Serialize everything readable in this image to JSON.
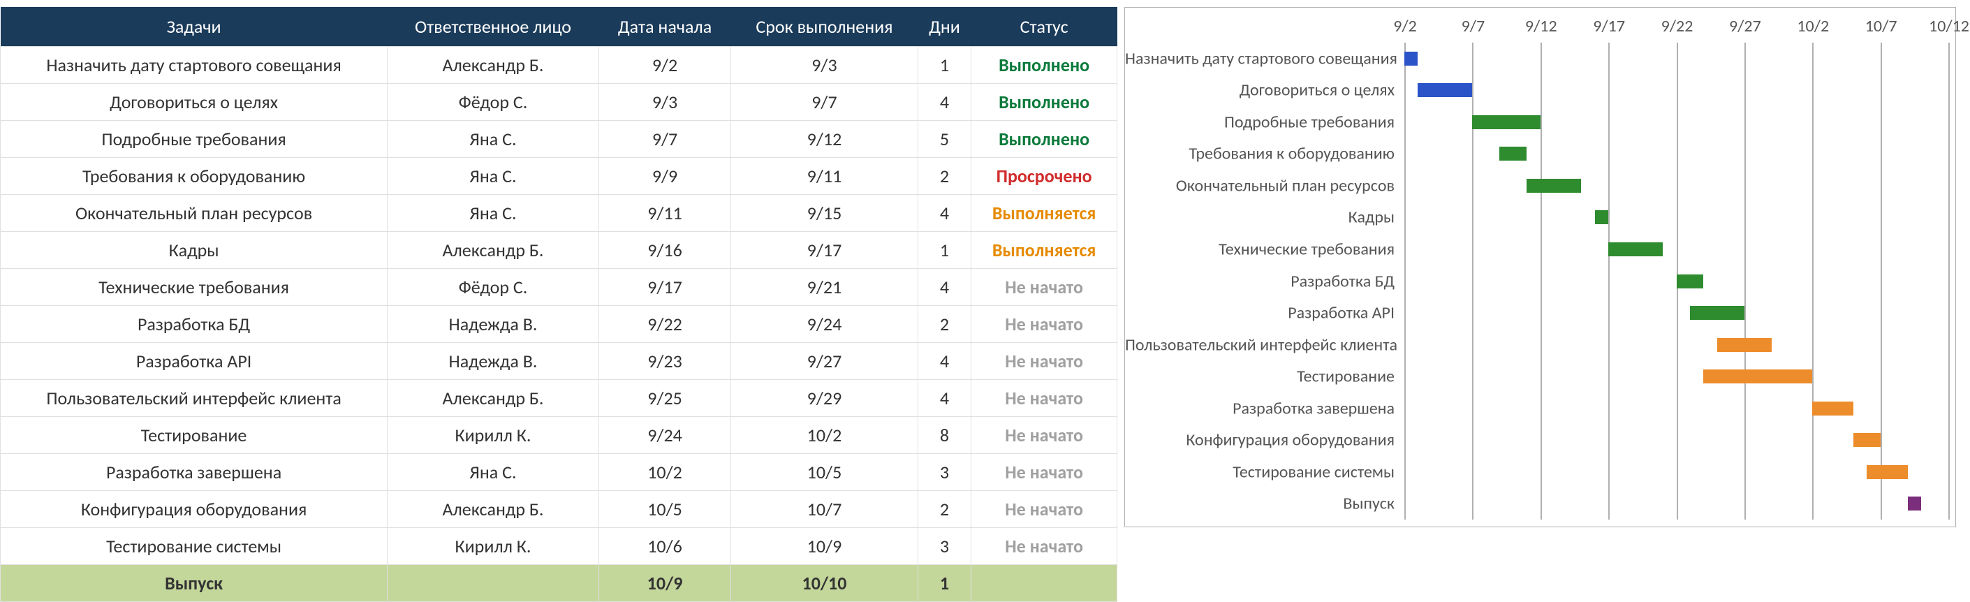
{
  "table": {
    "headers": [
      "Задачи",
      "Ответственное лицо",
      "Дата начала",
      "Срок выполнения",
      "Дни",
      "Статус"
    ],
    "rows": [
      {
        "task": "Назначить дату стартового совещания",
        "who": "Александр Б.",
        "start": "9/2",
        "end": "9/3",
        "days": "1",
        "status": "Выполнено",
        "status_kind": "done"
      },
      {
        "task": "Договориться о целях",
        "who": "Фёдор С.",
        "start": "9/3",
        "end": "9/7",
        "days": "4",
        "status": "Выполнено",
        "status_kind": "done"
      },
      {
        "task": "Подробные требования",
        "who": "Яна С.",
        "start": "9/7",
        "end": "9/12",
        "days": "5",
        "status": "Выполнено",
        "status_kind": "done"
      },
      {
        "task": "Требования к оборудованию",
        "who": "Яна С.",
        "start": "9/9",
        "end": "9/11",
        "days": "2",
        "status": "Просрочено",
        "status_kind": "late"
      },
      {
        "task": "Окончательный план ресурсов",
        "who": "Яна С.",
        "start": "9/11",
        "end": "9/15",
        "days": "4",
        "status": "Выполняется",
        "status_kind": "prog"
      },
      {
        "task": "Кадры",
        "who": "Александр Б.",
        "start": "9/16",
        "end": "9/17",
        "days": "1",
        "status": "Выполняется",
        "status_kind": "prog"
      },
      {
        "task": "Технические требования",
        "who": "Фёдор С.",
        "start": "9/17",
        "end": "9/21",
        "days": "4",
        "status": "Не начато",
        "status_kind": "ns"
      },
      {
        "task": "Разработка БД",
        "who": "Надежда В.",
        "start": "9/22",
        "end": "9/24",
        "days": "2",
        "status": "Не начато",
        "status_kind": "ns"
      },
      {
        "task": "Разработка API",
        "who": "Надежда В.",
        "start": "9/23",
        "end": "9/27",
        "days": "4",
        "status": "Не начато",
        "status_kind": "ns"
      },
      {
        "task": "Пользовательский интерфейс клиента",
        "who": "Александр Б.",
        "start": "9/25",
        "end": "9/29",
        "days": "4",
        "status": "Не начато",
        "status_kind": "ns"
      },
      {
        "task": "Тестирование",
        "who": "Кирилл К.",
        "start": "9/24",
        "end": "10/2",
        "days": "8",
        "status": "Не начато",
        "status_kind": "ns"
      },
      {
        "task": "Разработка завершена",
        "who": "Яна С.",
        "start": "10/2",
        "end": "10/5",
        "days": "3",
        "status": "Не начато",
        "status_kind": "ns"
      },
      {
        "task": "Конфигурация оборудования",
        "who": "Александр Б.",
        "start": "10/5",
        "end": "10/7",
        "days": "2",
        "status": "Не начато",
        "status_kind": "ns"
      },
      {
        "task": "Тестирование системы",
        "who": "Кирилл К.",
        "start": "10/6",
        "end": "10/9",
        "days": "3",
        "status": "Не начато",
        "status_kind": "ns"
      },
      {
        "task": "Выпуск",
        "who": "",
        "start": "10/9",
        "end": "10/10",
        "days": "1",
        "status": "",
        "status_kind": "milestone"
      }
    ]
  },
  "chart_data": {
    "type": "gantt",
    "x_ticks": [
      "9/2",
      "9/7",
      "9/12",
      "9/17",
      "9/22",
      "9/27",
      "10/2",
      "10/7",
      "10/12"
    ],
    "x_min_serial": 245,
    "x_max_serial": 285,
    "series": [
      {
        "name": "Назначить дату стартового совещания",
        "start": 245,
        "dur": 1,
        "color": "blue"
      },
      {
        "name": "Договориться о целях",
        "start": 246,
        "dur": 4,
        "color": "blue"
      },
      {
        "name": "Подробные требования",
        "start": 250,
        "dur": 5,
        "color": "green"
      },
      {
        "name": "Требования к оборудованию",
        "start": 252,
        "dur": 2,
        "color": "green"
      },
      {
        "name": "Окончательный план ресурсов",
        "start": 254,
        "dur": 4,
        "color": "green"
      },
      {
        "name": "Кадры",
        "start": 259,
        "dur": 1,
        "color": "green"
      },
      {
        "name": "Технические требования",
        "start": 260,
        "dur": 4,
        "color": "green"
      },
      {
        "name": "Разработка БД",
        "start": 265,
        "dur": 2,
        "color": "green"
      },
      {
        "name": "Разработка API",
        "start": 266,
        "dur": 4,
        "color": "green"
      },
      {
        "name": "Пользовательский интерфейс клиента",
        "start": 268,
        "dur": 4,
        "color": "orange"
      },
      {
        "name": "Тестирование",
        "start": 267,
        "dur": 8,
        "color": "orange"
      },
      {
        "name": "Разработка завершена",
        "start": 275,
        "dur": 3,
        "color": "orange"
      },
      {
        "name": "Конфигурация оборудования",
        "start": 278,
        "dur": 2,
        "color": "orange"
      },
      {
        "name": "Тестирование системы",
        "start": 279,
        "dur": 3,
        "color": "orange"
      },
      {
        "name": "Выпуск",
        "start": 282,
        "dur": 1,
        "color": "purple"
      }
    ],
    "tick_serials": [
      245,
      250,
      255,
      260,
      265,
      270,
      275,
      280,
      285
    ]
  }
}
